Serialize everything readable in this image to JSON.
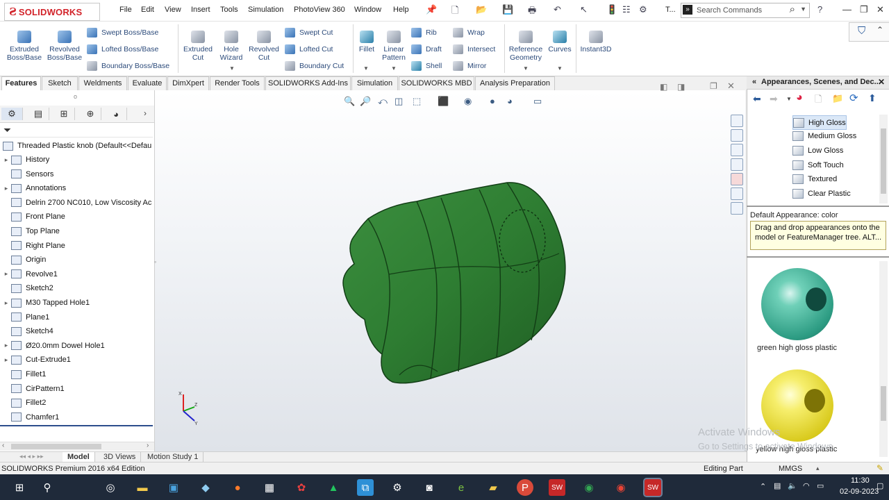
{
  "app": {
    "logo": "SOLIDWORKS",
    "logo_prefix": "3S"
  },
  "menu": [
    "File",
    "Edit",
    "View",
    "Insert",
    "Tools",
    "Simulation",
    "PhotoView 360",
    "Window",
    "Help"
  ],
  "search": {
    "placeholder": "Search Commands"
  },
  "toolbar_extra": {
    "truncated": "T..."
  },
  "commands": {
    "extruded_boss": "Extruded Boss/Base",
    "revolved_boss": "Revolved Boss/Base",
    "swept_boss": "Swept Boss/Base",
    "lofted_boss": "Lofted Boss/Base",
    "boundary_boss": "Boundary Boss/Base",
    "extruded_cut": "Extruded Cut",
    "hole_wizard": "Hole Wizard",
    "revolved_cut": "Revolved Cut",
    "swept_cut": "Swept Cut",
    "lofted_cut": "Lofted Cut",
    "boundary_cut": "Boundary Cut",
    "fillet": "Fillet",
    "linear_pattern": "Linear Pattern",
    "rib": "Rib",
    "draft": "Draft",
    "shell": "Shell",
    "wrap": "Wrap",
    "intersect": "Intersect",
    "mirror": "Mirror",
    "reference_geometry": "Reference Geometry",
    "curves": "Curves",
    "instant3d": "Instant3D"
  },
  "tabs": [
    "Features",
    "Sketch",
    "Weldments",
    "Evaluate",
    "DimXpert",
    "Render Tools",
    "SOLIDWORKS Add-Ins",
    "Simulation",
    "SOLIDWORKS MBD",
    "Analysis Preparation"
  ],
  "tree": {
    "root": "Threaded Plastic knob  (Default<<Defau",
    "items": [
      {
        "label": "History",
        "expand": true
      },
      {
        "label": "Sensors",
        "expand": false
      },
      {
        "label": "Annotations",
        "expand": true
      },
      {
        "label": "Delrin 2700 NC010, Low Viscosity Ac",
        "expand": false
      },
      {
        "label": "Front Plane",
        "expand": false
      },
      {
        "label": "Top Plane",
        "expand": false
      },
      {
        "label": "Right Plane",
        "expand": false
      },
      {
        "label": "Origin",
        "expand": false
      },
      {
        "label": "Revolve1",
        "expand": true
      },
      {
        "label": "Sketch2",
        "expand": false
      },
      {
        "label": "M30 Tapped Hole1",
        "expand": true
      },
      {
        "label": "Plane1",
        "expand": false
      },
      {
        "label": "Sketch4",
        "expand": false
      },
      {
        "label": "Ø20.0mm Dowel Hole1",
        "expand": true
      },
      {
        "label": "Cut-Extrude1",
        "expand": true
      },
      {
        "label": "Fillet1",
        "expand": false
      },
      {
        "label": "CirPattern1",
        "expand": false
      },
      {
        "label": "Fillet2",
        "expand": false
      },
      {
        "label": "Chamfer1",
        "expand": false
      }
    ]
  },
  "taskpane": {
    "title": "Appearances, Scenes, and Dec...",
    "items": [
      "High Gloss",
      "Medium Gloss",
      "Low Gloss",
      "Soft Touch",
      "Textured",
      "Clear Plastic"
    ],
    "selected": "High Gloss",
    "default_appearance": "Default Appearance: color",
    "tip": "Drag and drop appearances onto the model or FeatureManager tree.  ALT...",
    "swatches": [
      "green high gloss plastic",
      "yellow high gloss plastic"
    ],
    "colors": {
      "green": "#3fb8a0",
      "yellow": "#f0e43a"
    }
  },
  "bottom_tabs": [
    "Model",
    "3D Views",
    "Motion Study 1"
  ],
  "status": {
    "left": "SOLIDWORKS Premium 2016 x64 Edition",
    "mode": "Editing Part",
    "units": "MMGS"
  },
  "watermark": {
    "line1": "Activate Windows",
    "line2": "Go to Settings to activate Windows."
  },
  "clock": {
    "time": "11:30",
    "date": "02-09-2023"
  },
  "model": {
    "color": "#2e7d32"
  }
}
